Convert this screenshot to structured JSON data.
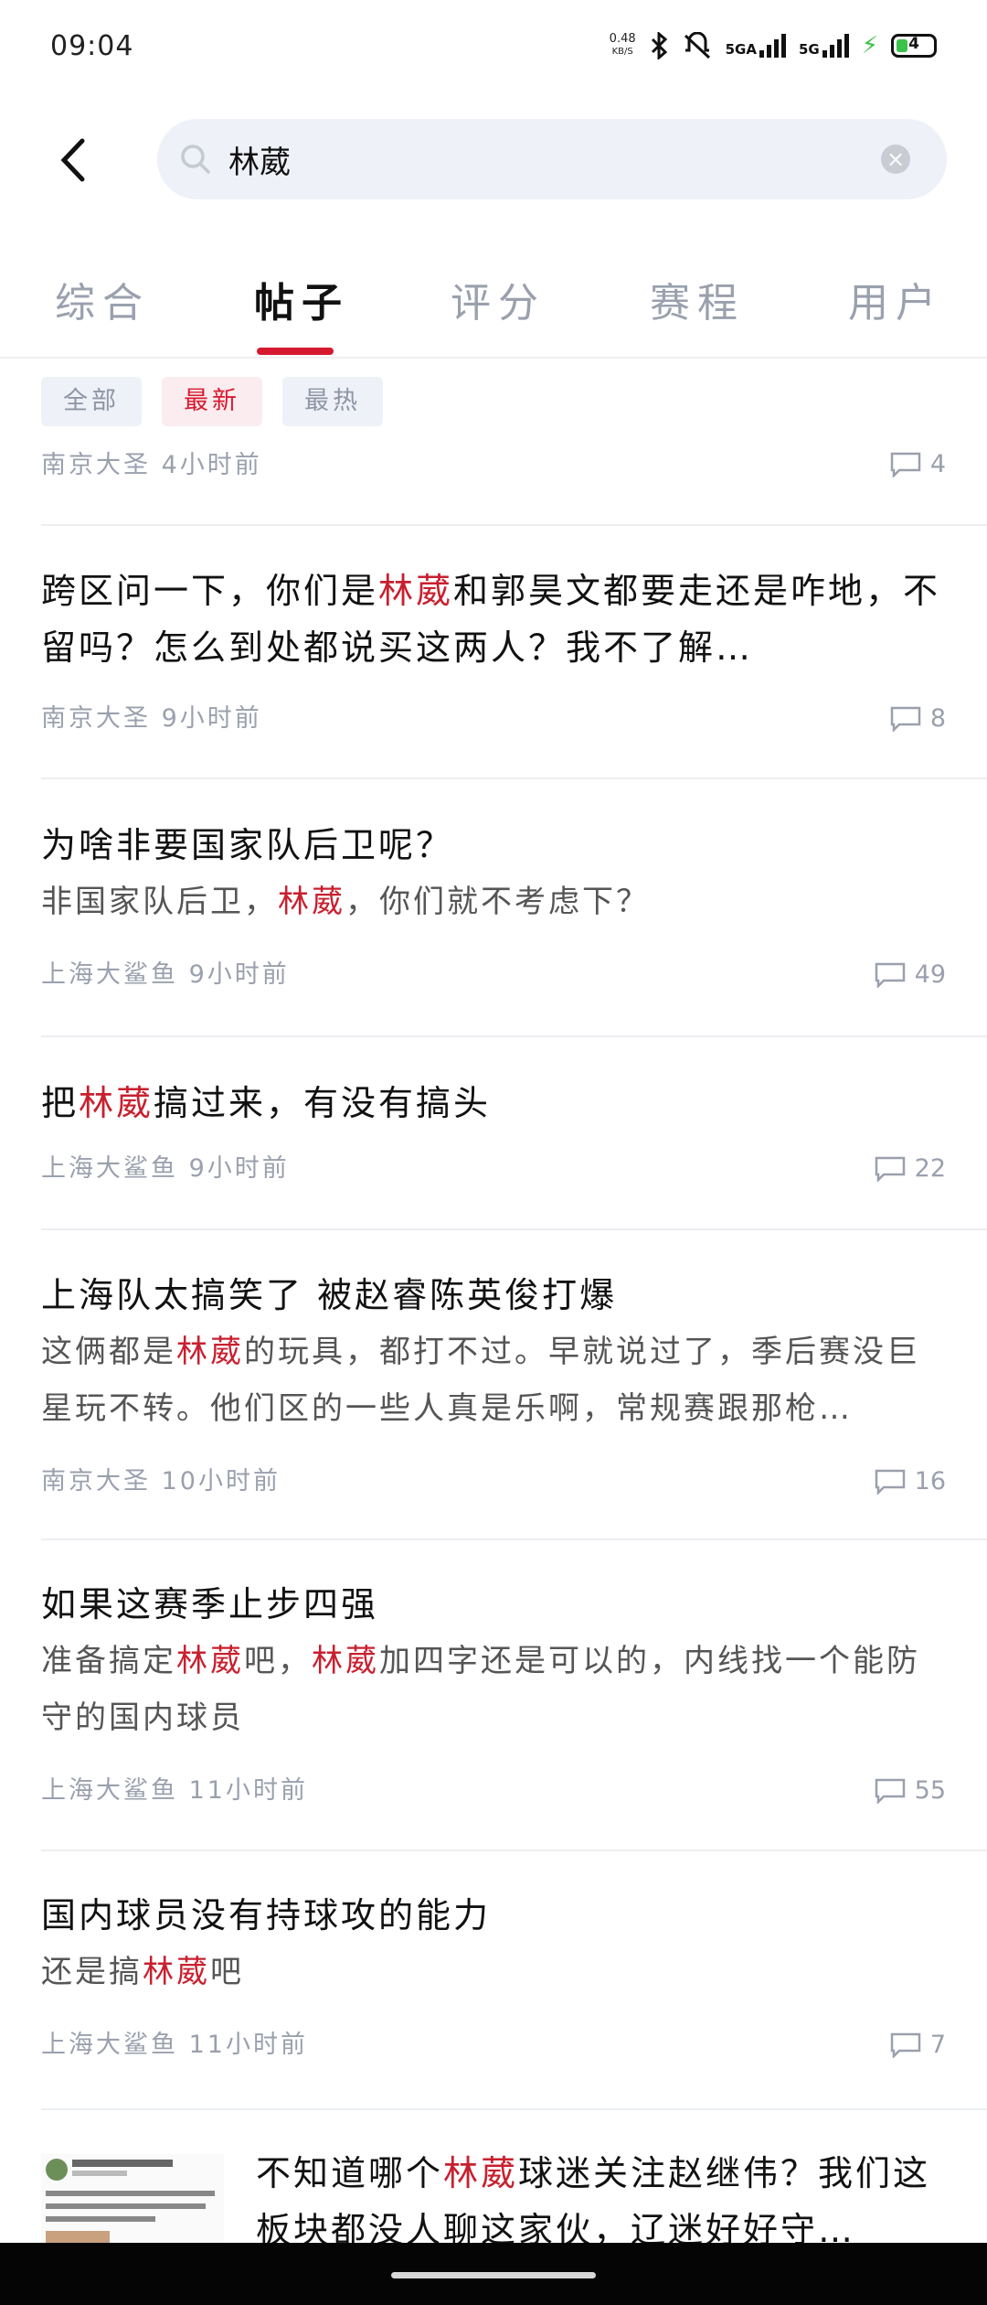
{
  "status_bar": {
    "time": "09:04",
    "net_speed_value": "0.48",
    "net_speed_unit": "KB/S",
    "sig1": "5GA",
    "sig2": "5G",
    "battery": "4"
  },
  "search": {
    "query": "林葳"
  },
  "tabs": [
    {
      "label": "综合"
    },
    {
      "label": "帖子",
      "active": true
    },
    {
      "label": "评分"
    },
    {
      "label": "赛程"
    },
    {
      "label": "用户"
    }
  ],
  "filters": [
    {
      "label": "全部"
    },
    {
      "label": "最新",
      "active": true
    },
    {
      "label": "最热"
    }
  ],
  "highlight": "林葳",
  "posts": [
    {
      "title": "",
      "body": "",
      "author": "南京大圣",
      "time": "4小时前",
      "comments": "4"
    },
    {
      "title": "跨区问一下，你们是林葳和郭昊文都要走还是咋地，不留吗？怎么到处都说买这两人？我不了解…",
      "body": "",
      "author": "南京大圣",
      "time": "9小时前",
      "comments": "8"
    },
    {
      "title": "为啥非要国家队后卫呢？",
      "body": "非国家队后卫，林葳，你们就不考虑下？",
      "author": "上海大鲨鱼",
      "time": "9小时前",
      "comments": "49"
    },
    {
      "title": "把林葳搞过来，有没有搞头",
      "body": "",
      "author": "上海大鲨鱼",
      "time": "9小时前",
      "comments": "22"
    },
    {
      "title": "上海队太搞笑了 被赵睿陈英俊打爆",
      "body": "这俩都是林葳的玩具，都打不过。早就说过了，季后赛没巨星玩不转。他们区的一些人真是乐啊，常规赛跟那枪…",
      "author": "南京大圣",
      "time": "10小时前",
      "comments": "16"
    },
    {
      "title": "如果这赛季止步四强",
      "body": "准备搞定林葳吧，林葳加四字还是可以的，内线找一个能防守的国内球员",
      "author": "上海大鲨鱼",
      "time": "11小时前",
      "comments": "55"
    },
    {
      "title": "国内球员没有持球攻的能力",
      "body": "还是搞林葳吧",
      "author": "上海大鲨鱼",
      "time": "11小时前",
      "comments": "7"
    },
    {
      "title": "不知道哪个林葳球迷关注赵继伟？我们这板块都没人聊这家伙，辽迷好好守…",
      "body": "",
      "author": "",
      "time": "",
      "comments": ""
    }
  ]
}
